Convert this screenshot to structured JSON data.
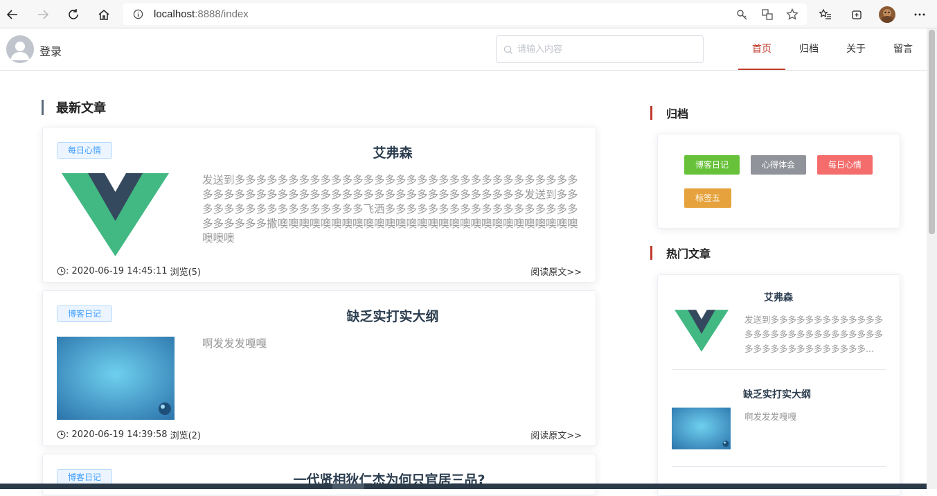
{
  "browser": {
    "url_host": "localhost",
    "url_path": ":8888/index"
  },
  "header": {
    "login_label": "登录",
    "search_placeholder": "请输入内容",
    "nav": [
      {
        "label": "首页",
        "active": true
      },
      {
        "label": "归档",
        "active": false
      },
      {
        "label": "关于",
        "active": false
      },
      {
        "label": "留言",
        "active": false
      }
    ],
    "accent_color": "#c0392b"
  },
  "main": {
    "section_title": "最新文章",
    "articles": [
      {
        "tag": "每日心情",
        "title": "艾弗森",
        "thumbnail": "vue-logo",
        "excerpt": "发送到多多多多多多多多多多多多多多多多多多多多多多多多多多多多多多多多多多多多多多多多多多多多多多多多多多多多多多多多多多多多多多发送到多多多多多多多多多多多多多多多多多飞洒多多多多多多多多多多多多多多多多多多多多多多多多撒噢噢噢噢噢噢噢噢噢噢噢噢噢噢噢噢噢噢噢噢噢噢噢噢噢噢噢噢噢噢噢",
        "date": ": 2020-06-19 14:45:11",
        "views": "浏览(5)",
        "read_more": "阅读原文>>"
      },
      {
        "tag": "博客日记",
        "title": "缺乏实打实大纲",
        "thumbnail": "blue-wallpaper",
        "excerpt": "啊发发发嘎嘎",
        "date": ": 2020-06-19 14:39:58",
        "views": "浏览(2)",
        "read_more": "阅读原文>>"
      },
      {
        "tag": "博客日记",
        "title": "一代贤相狄仁杰为何只官居三品?"
      }
    ]
  },
  "sidebar": {
    "archive_title": "归档",
    "archive_tags": [
      {
        "label": "博客日记",
        "color": "#67c23a"
      },
      {
        "label": "心得体会",
        "color": "#909399"
      },
      {
        "label": "每日心情",
        "color": "#f56c6c"
      },
      {
        "label": "标签五",
        "color": "#e6a23c"
      }
    ],
    "hot_title": "热门文章",
    "hot_articles": [
      {
        "title": "艾弗森",
        "excerpt": "发送到多多多多多多多多多多多多多多多多多多多多多多多多多多多多多多多多多多多多多多多多多多多...",
        "thumbnail": "vue-logo"
      },
      {
        "title": "缺乏实打实大纲",
        "excerpt": "啊发发发嘎嘎",
        "thumbnail": "blue-wallpaper"
      }
    ]
  }
}
